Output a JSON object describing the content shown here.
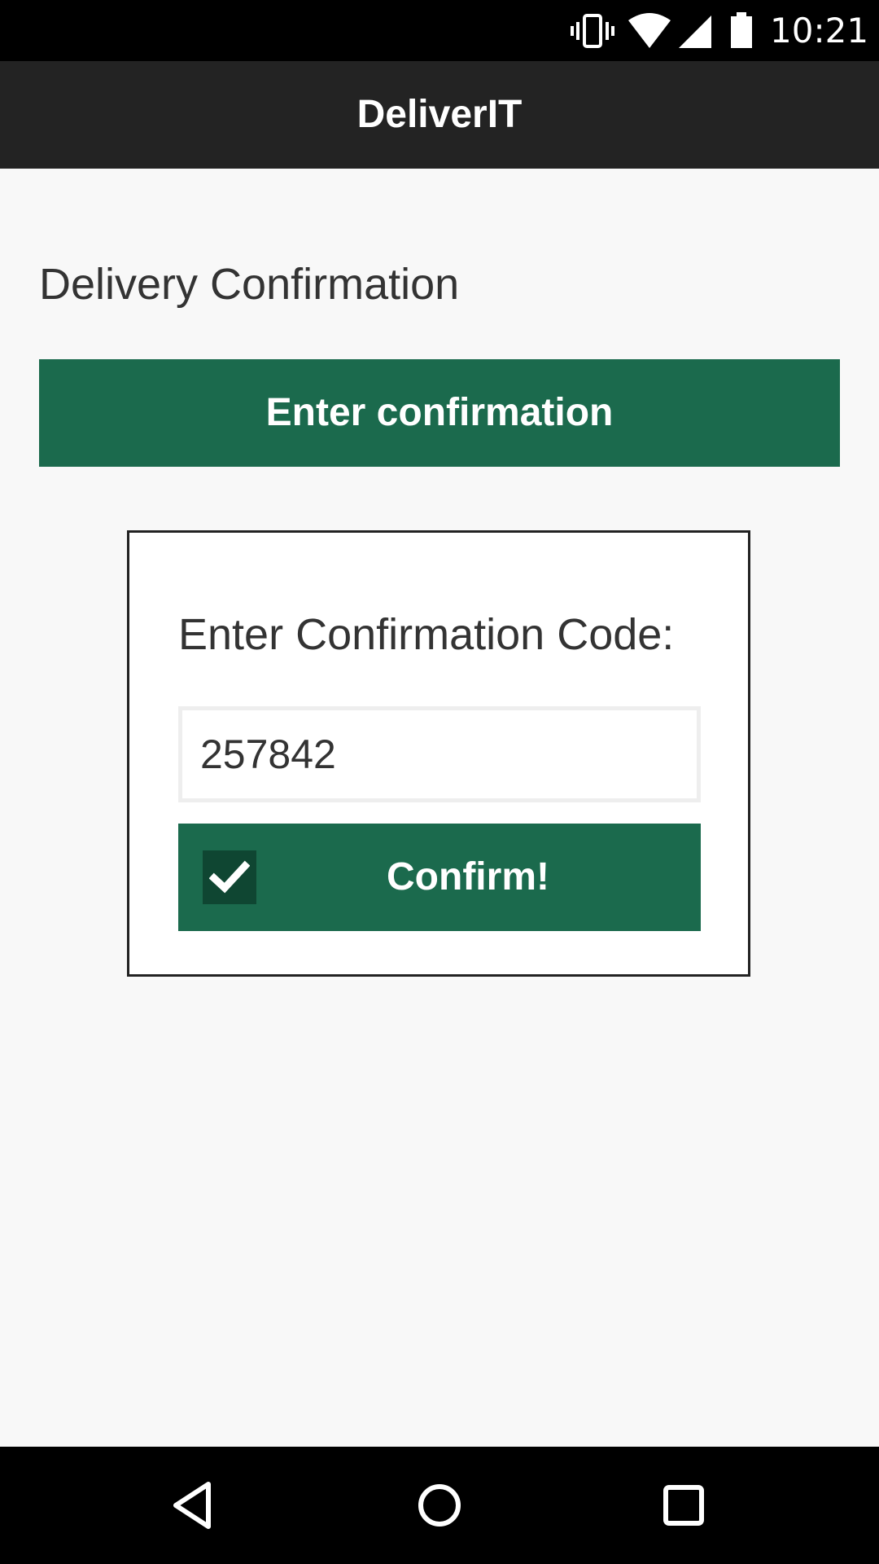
{
  "status_bar": {
    "time": "10:21",
    "icons": [
      "vibrate-icon",
      "wifi-icon",
      "signal-icon",
      "battery-icon"
    ]
  },
  "app_bar": {
    "title": "DeliverIT"
  },
  "main": {
    "page_title": "Delivery Confirmation",
    "enter_confirmation_button": "Enter confirmation",
    "card": {
      "code_label": "Enter Confirmation Code:",
      "code_value": "257842",
      "confirm_button": "Confirm!",
      "confirm_icon": "checkmark-icon"
    }
  },
  "nav_bar": {
    "buttons": [
      "back-icon",
      "home-icon",
      "recents-icon"
    ]
  },
  "colors": {
    "primary_green": "#1b6a4d",
    "dark_green": "#0f4632",
    "app_bar": "#232323",
    "background": "#f8f8f8"
  }
}
